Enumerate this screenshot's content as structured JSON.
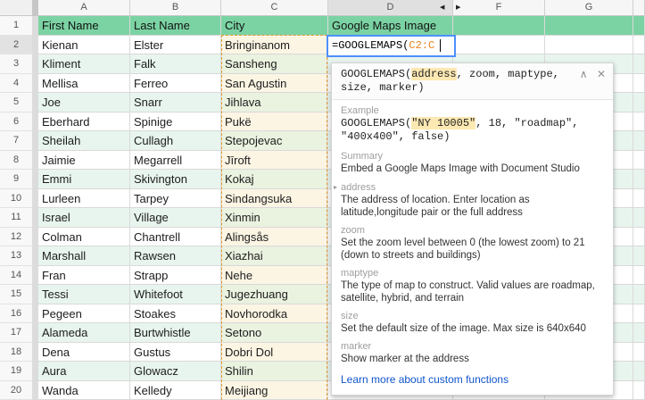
{
  "colors": {
    "header_row_green": "#7bd3a3",
    "banded_row_green": "#e8f5ee",
    "plain_row_white": "#ffffff",
    "referenced_col_on_white": "#fcf5e4",
    "referenced_col_on_green": "#eaf2e0",
    "range_dash_orange": "#e49a2e",
    "edit_border_blue": "#4d90fe",
    "formula_range_orange": "#e8821e",
    "highlight_yellow": "#fce8b2",
    "link_blue": "#1155cc",
    "gridline": "#d9d9d9"
  },
  "icons": {
    "collapse": "∧",
    "close": "✕",
    "active_param_marker": "▸",
    "hidden_column_left": "◀",
    "hidden_column_right": "▶"
  },
  "spreadsheet": {
    "column_headers": [
      "A",
      "B",
      "C",
      "D",
      "F",
      "G",
      ""
    ],
    "header_row": [
      "First Name",
      "Last Name",
      "City",
      "Google Maps Image",
      "",
      "",
      ""
    ],
    "header_row_number": 1,
    "rows": [
      {
        "n": 2,
        "first": "Kienan",
        "last": "Elster",
        "city": "Bringinanom"
      },
      {
        "n": 3,
        "first": "Kliment",
        "last": "Falk",
        "city": "Sansheng"
      },
      {
        "n": 4,
        "first": "Mellisa",
        "last": "Ferreo",
        "city": "San Agustin"
      },
      {
        "n": 5,
        "first": "Joe",
        "last": "Snarr",
        "city": "Jihlava"
      },
      {
        "n": 6,
        "first": "Eberhard",
        "last": "Spinige",
        "city": "Pukë"
      },
      {
        "n": 7,
        "first": "Sheilah",
        "last": "Cullagh",
        "city": "Stepojevac"
      },
      {
        "n": 8,
        "first": "Jaimie",
        "last": "Megarrell",
        "city": "Jīroft"
      },
      {
        "n": 9,
        "first": "Emmi",
        "last": "Skivington",
        "city": "Kokaj"
      },
      {
        "n": 10,
        "first": "Lurleen",
        "last": "Tarpey",
        "city": "Sindangsuka"
      },
      {
        "n": 11,
        "first": "Israel",
        "last": "Village",
        "city": "Xinmin"
      },
      {
        "n": 12,
        "first": "Colman",
        "last": "Chantrell",
        "city": "Alingsås"
      },
      {
        "n": 13,
        "first": "Marshall",
        "last": "Rawsen",
        "city": "Xiazhai"
      },
      {
        "n": 14,
        "first": "Fran",
        "last": "Strapp",
        "city": "Nehe"
      },
      {
        "n": 15,
        "first": "Tessi",
        "last": "Whitefoot",
        "city": "Jugezhuang"
      },
      {
        "n": 16,
        "first": "Pegeen",
        "last": "Stoakes",
        "city": "Novhorodka"
      },
      {
        "n": 17,
        "first": "Alameda",
        "last": "Burtwhistle",
        "city": "Setono"
      },
      {
        "n": 18,
        "first": "Dena",
        "last": "Gustus",
        "city": "Dobri Dol"
      },
      {
        "n": 19,
        "first": "Aura",
        "last": "Glowacz",
        "city": "Shilin"
      },
      {
        "n": 20,
        "first": "Wanda",
        "last": "Kelledy",
        "city": "Meijiang"
      }
    ]
  },
  "edit_cell": {
    "formula_prefix": "=GOOGLEMAPS(",
    "formula_range": "C2:C"
  },
  "tooltip": {
    "signature": {
      "prefix": "GOOGLEMAPS(",
      "highlight": "address",
      "suffix": ", zoom, maptype, size, marker)"
    },
    "example_label": "Example",
    "example": {
      "prefix": "GOOGLEMAPS(",
      "highlight": "\"NY 10005\"",
      "suffix": ", 18, \"roadmap\", \"400x400\", false)"
    },
    "summary_label": "Summary",
    "summary": "Embed a Google Maps Image with Document Studio",
    "params": [
      {
        "name": "address",
        "active": true,
        "description": "The address of location. Enter location as latitude,longitude pair or the full address"
      },
      {
        "name": "zoom",
        "description": "Set the zoom level between 0 (the lowest zoom) to 21 (down to streets and buildings)"
      },
      {
        "name": "maptype",
        "description": "The type of map to construct. Valid values are roadmap, satellite, hybrid, and terrain"
      },
      {
        "name": "size",
        "description": "Set the default size of the image. Max size is 640x640"
      },
      {
        "name": "marker",
        "description": "Show marker at the address"
      }
    ],
    "link_text": "Learn more about custom functions"
  }
}
